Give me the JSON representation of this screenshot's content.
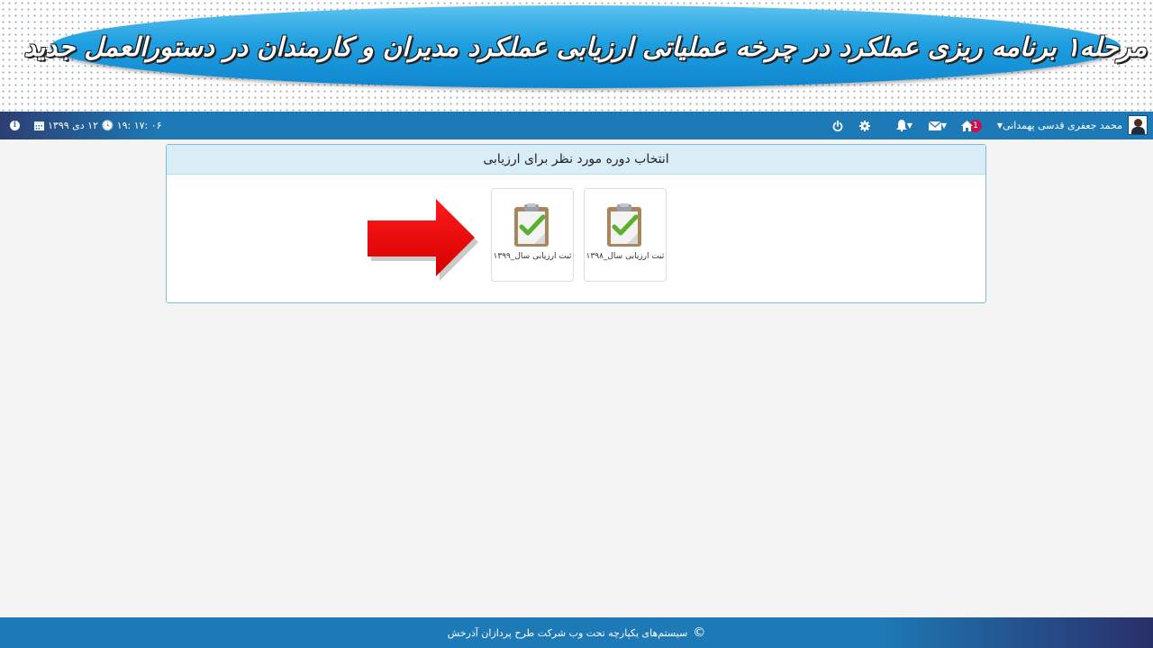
{
  "banner": {
    "title": "مرحله۱ برنامه ریزی عملکرد در چرخه عملیاتی ارزیابی عملکرد مدیران و کارمندان در دستورالعمل جدید"
  },
  "navbar": {
    "user_name": "محمد جعفری قدسی پهمدانی",
    "notification_count": "1",
    "datetime": "۰۶ :۱۷ :۱۹ 🕓 ۱۲ دی ۱۳۹۹",
    "icons": [
      "avatar",
      "caret-down-icon",
      "home-icon",
      "envelope-icon",
      "bell-icon",
      "gear-icon",
      "power-icon",
      "calendar-icon",
      "clock-icon",
      "info-icon"
    ],
    "accent_color": "#1d7ab6"
  },
  "panel": {
    "heading": "انتخاب دوره مورد نظر برای ارزیابی",
    "cards": [
      {
        "label": "ثبت ارزیابی سال_۱۳۹۸",
        "icon": "clipboard-check-icon"
      },
      {
        "label": "ثبت ارزیابی سال_۱۳۹۹",
        "icon": "clipboard-check-icon"
      }
    ],
    "pointer": "red-arrow-icon",
    "heading_bg": "#d9edf7"
  },
  "footer": {
    "copyright_symbol": "©",
    "text": "سیستم‌های یکپارچه تحت وب شرکت طرح پردازان آذرخش"
  }
}
